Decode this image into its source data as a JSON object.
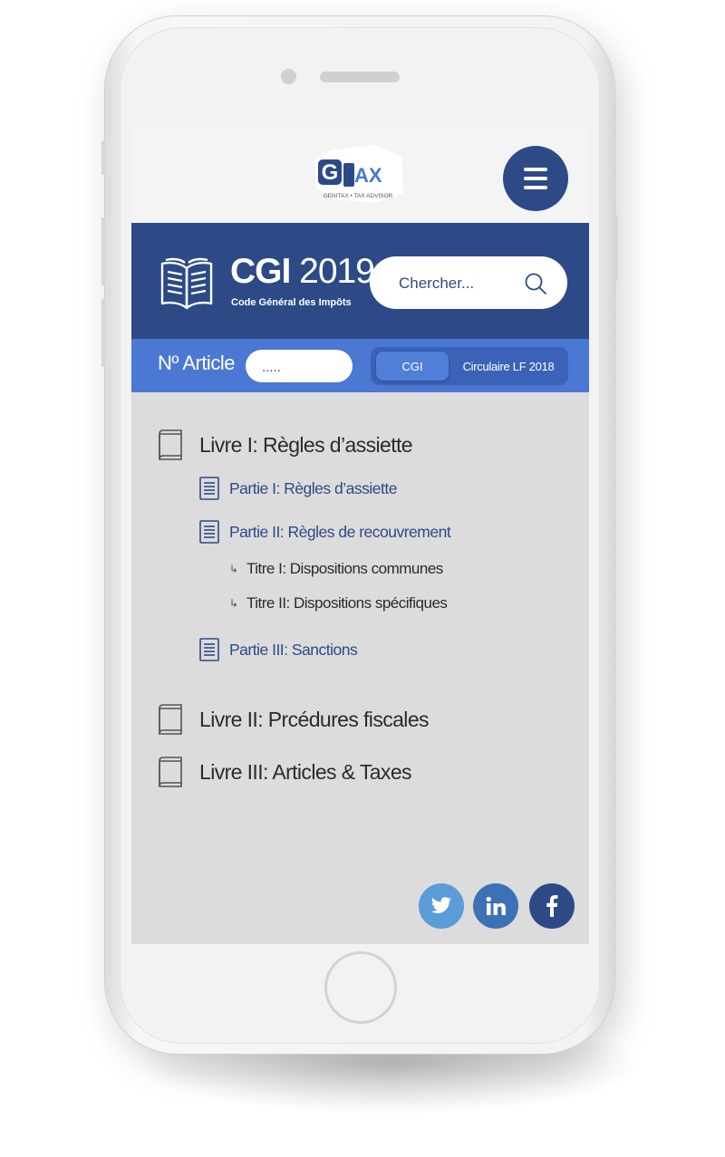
{
  "app": {
    "logo_text": "GTAX",
    "logo_tagline": "GENITAX • TAX ADVISOR"
  },
  "header": {
    "title_bold": "CGI",
    "title_year": " 2019",
    "subtitle": "Code Général des Impôts",
    "search_placeholder": "Chercher..."
  },
  "article_bar": {
    "label": "Nº Article",
    "input_placeholder": ".....",
    "toggle_options": [
      "CGI",
      "Circulaire LF 2018"
    ],
    "selected_option": "CGI"
  },
  "tree": {
    "livres": [
      {
        "label": "Livre I: Règles d’assiette",
        "parties": [
          {
            "label": "Partie I: Règles d’assiette",
            "titres": []
          },
          {
            "label": "Partie II: Règles de recouvrement",
            "titres": [
              {
                "label": "Titre I: Dispositions communes"
              },
              {
                "label": "Titre II: Dispositions spécifiques"
              }
            ]
          },
          {
            "label": "Partie III: Sanctions",
            "titres": []
          }
        ]
      },
      {
        "label": "Livre II: Prcédures fiscales",
        "parties": []
      },
      {
        "label": "Livre III: Articles & Taxes",
        "parties": []
      }
    ]
  },
  "social": {
    "twitter": "twitter-icon",
    "linkedin": "linkedin-icon",
    "facebook": "facebook-icon"
  },
  "colors": {
    "primary": "#2d4a87",
    "secondary": "#4a78d2",
    "twitter": "#5b9bd8",
    "linkedin": "#3d71b5",
    "facebook": "#2d4a87",
    "background": "#dcdcdc"
  }
}
